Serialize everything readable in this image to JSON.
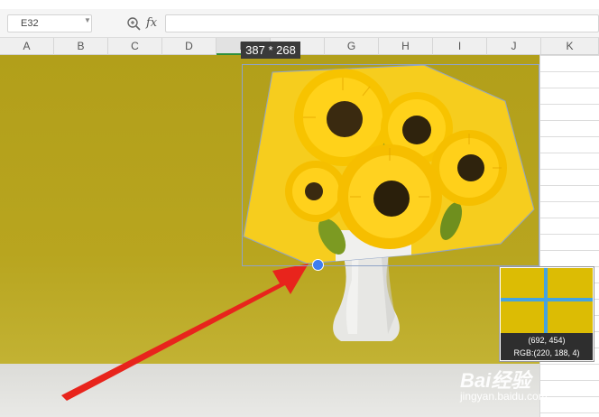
{
  "formula_bar": {
    "name_box_value": "E32",
    "fx_label": "fx",
    "formula_value": ""
  },
  "columns": [
    "A",
    "B",
    "C",
    "D",
    "E",
    "F",
    "G",
    "H",
    "I",
    "J",
    "K"
  ],
  "selected_column": "E",
  "image": {
    "size_label": "387 * 268"
  },
  "magnifier": {
    "coords": "(692, 454)",
    "rgb": "RGB:(220, 188, 4)"
  },
  "watermark": {
    "logo": "Bai经验",
    "url": "jingyan.baidu.com"
  },
  "colors": {
    "background_wall": "#b29f1a",
    "sunflower_petal": "#f6c91a",
    "crop_border": "#8fa3c7",
    "handle": "#3e7ef0",
    "arrow": "#e8241c",
    "sampled_color": "#dcbc04"
  }
}
